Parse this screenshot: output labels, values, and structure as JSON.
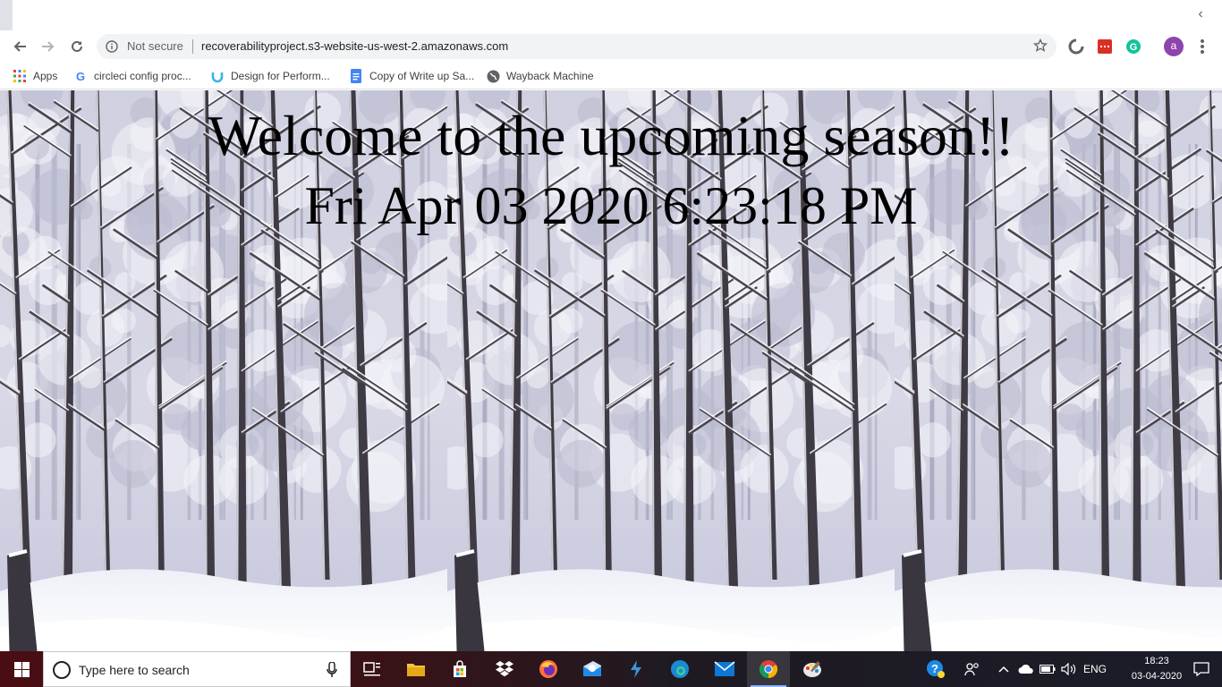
{
  "browser": {
    "security_label": "Not secure",
    "url": "recoverabilityproject.s3-website-us-west-2.amazonaws.com",
    "avatar_letter": "a",
    "bookmarks": [
      {
        "label": "Apps",
        "icon": "apps-grid-icon"
      },
      {
        "label": "circleci config proc...",
        "icon": "google-icon"
      },
      {
        "label": "Design for Perform...",
        "icon": "udemy-icon"
      },
      {
        "label": "Copy of Write up Sa...",
        "icon": "google-docs-icon"
      },
      {
        "label": "Wayback Machine",
        "icon": "globe-icon"
      }
    ]
  },
  "page": {
    "headline": "Welcome to the upcoming season!!",
    "datetime": "Fri Apr 03 2020 6:23:18 PM",
    "background": "snowy-forest-image"
  },
  "taskbar": {
    "search_placeholder": "Type here to search",
    "apps": [
      "task-view",
      "file-explorer",
      "microsoft-store",
      "dropbox",
      "firefox",
      "outlook",
      "visual-studio",
      "edge",
      "mail",
      "chrome",
      "paint"
    ],
    "active_app": "chrome",
    "language": "ENG",
    "time": "18:23",
    "date": "03-04-2020"
  },
  "colors": {
    "chrome_frame": "#dee1e6",
    "omnibox": "#f1f3f4",
    "taskbar": "#3a1216",
    "avatar": "#8e44ad"
  }
}
